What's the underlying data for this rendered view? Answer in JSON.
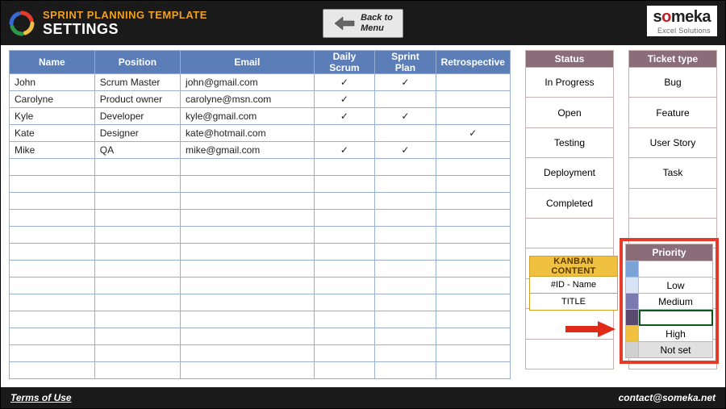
{
  "header": {
    "template_title": "SPRINT PLANNING TEMPLATE",
    "page_title": "SETTINGS",
    "back_line1": "Back to",
    "back_line2": "Menu",
    "brand_name_prefix": "s",
    "brand_name_o": "o",
    "brand_name_rest": "meka",
    "brand_sub": "Excel Solutions"
  },
  "columns": {
    "name": "Name",
    "position": "Position",
    "email": "Email",
    "daily": "Daily Scrum",
    "sprint": "Sprint Plan",
    "retro": "Retrospective"
  },
  "people": [
    {
      "name": "John",
      "position": "Scrum Master",
      "email": "john@gmail.com",
      "daily": "✓",
      "sprint": "✓",
      "retro": ""
    },
    {
      "name": "Carolyne",
      "position": "Product owner",
      "email": "carolyne@msn.com",
      "daily": "✓",
      "sprint": "",
      "retro": ""
    },
    {
      "name": "Kyle",
      "position": "Developer",
      "email": "kyle@gmail.com",
      "daily": "✓",
      "sprint": "✓",
      "retro": ""
    },
    {
      "name": "Kate",
      "position": "Designer",
      "email": "kate@hotmail.com",
      "daily": "",
      "sprint": "",
      "retro": "✓"
    },
    {
      "name": "Mike",
      "position": "QA",
      "email": "mike@gmail.com",
      "daily": "✓",
      "sprint": "✓",
      "retro": ""
    }
  ],
  "empty_people_rows": 13,
  "status": {
    "header": "Status",
    "items": [
      "In Progress",
      "Open",
      "Testing",
      "Deployment",
      "Completed"
    ],
    "empty": 5
  },
  "ticket": {
    "header": "Ticket type",
    "items": [
      "Bug",
      "Feature",
      "User Story",
      "Task"
    ],
    "empty": 6
  },
  "kanban": {
    "header": "KANBAN CONTENT",
    "rows": [
      "#ID - Name",
      "TITLE"
    ]
  },
  "priority": {
    "header": "Priority",
    "items": [
      {
        "label": "",
        "color": "#7aa3d8",
        "selected": false
      },
      {
        "label": "Low",
        "color": "#d8e4f5",
        "selected": false
      },
      {
        "label": "Medium",
        "color": "#7a7ab0",
        "selected": false
      },
      {
        "label": "",
        "color": "#5a4a70",
        "selected": true
      },
      {
        "label": "High",
        "color": "#f0c040",
        "selected": false
      },
      {
        "label": "Not set",
        "color": "#d0d0d0",
        "selected": false,
        "notset": true
      }
    ]
  },
  "footer": {
    "terms": "Terms of Use",
    "contact": "contact@someka.net"
  }
}
